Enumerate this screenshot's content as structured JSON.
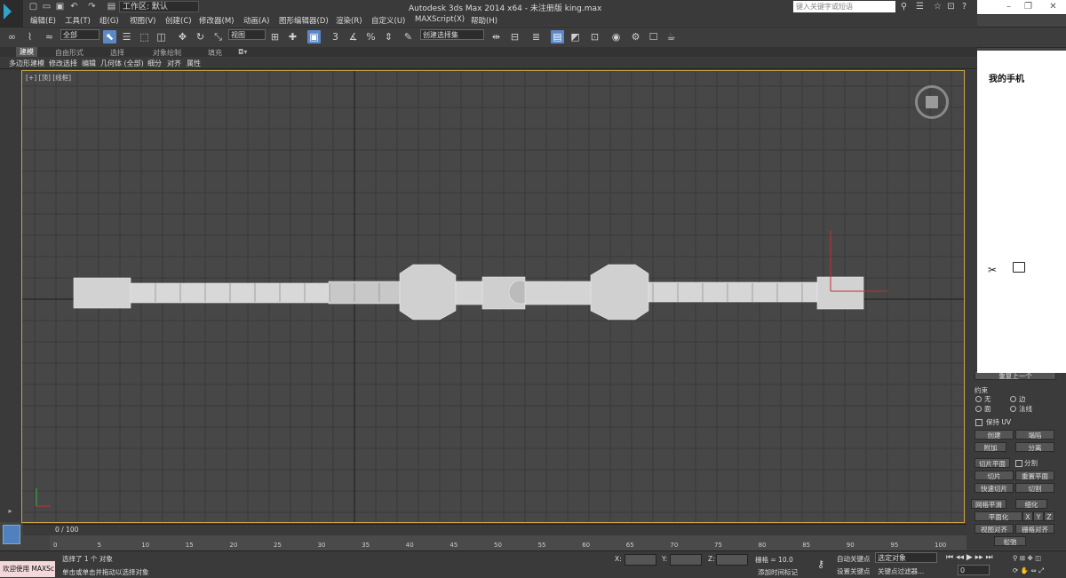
{
  "title_bar": {
    "workspace": "工作区: 默认",
    "window_title": "Autodesk 3ds Max  2014 x64   - 未注册版    king.max",
    "search_placeholder": "键入关键字或短语"
  },
  "menu": [
    "编辑(E)",
    "工具(T)",
    "组(G)",
    "视图(V)",
    "创建(C)",
    "修改器(M)",
    "动画(A)",
    "图形编辑器(D)",
    "渲染(R)",
    "自定义(U)",
    "MAXScript(X)",
    "帮助(H)"
  ],
  "toolbar": {
    "filter_select": "全部",
    "ref_coord_select": "视图",
    "named_selection": "创建选择集"
  },
  "ribbon": {
    "tabs": [
      "建模",
      "自由形式",
      "选择",
      "对象绘制",
      "填充"
    ],
    "sub_items": [
      "多边形建模",
      "修改选择",
      "编辑",
      "几何体 (全部)",
      "细分",
      "对齐",
      "属性"
    ]
  },
  "viewport": {
    "label": "[+] [顶] [线框]"
  },
  "phone_panel": {
    "title": "我的手机"
  },
  "command_panel": {
    "repeat_label": "重复上一个",
    "constraints_label": "约束",
    "constraint_none": "无",
    "constraint_edge": "边",
    "constraint_face": "面",
    "constraint_normal": "法线",
    "preserve_uv": "保持 UV",
    "create": "创建",
    "collapse": "塌陷",
    "attach": "附加",
    "detach": "分离",
    "slice_plane": "切片平面",
    "split": "分割",
    "slice": "切片",
    "reset_plane": "重置平面",
    "quickslice": "快速切片",
    "cut": "切割",
    "meshsmooth": "网格平滑",
    "tessellate": "细化",
    "make_planar": "平面化",
    "x": "X",
    "y": "Y",
    "z": "Z",
    "view_align": "视图对齐",
    "grid_align": "栅格对齐",
    "relax": "松弛"
  },
  "timeline": {
    "frame_display": "0 / 100",
    "ticks": [
      "0",
      "5",
      "10",
      "15",
      "20",
      "25",
      "30",
      "35",
      "40",
      "45",
      "50",
      "55",
      "60",
      "65",
      "70",
      "75",
      "80",
      "85",
      "90",
      "95",
      "100"
    ]
  },
  "status": {
    "maxscript": "欢迎使用 MAXSc",
    "selected": "选择了 1 个 对象",
    "prompt": "单击或单击并拖动以选择对象",
    "x_label": "X:",
    "y_label": "Y:",
    "z_label": "Z:",
    "grid": "栅格 = 10.0",
    "auto_key": "自动关键点",
    "set_key": "设置关键点",
    "selected_obj": "选定对象",
    "key_filters": "关键点过滤器...",
    "add_time_tag": "添加时间标记",
    "frame": "0"
  }
}
